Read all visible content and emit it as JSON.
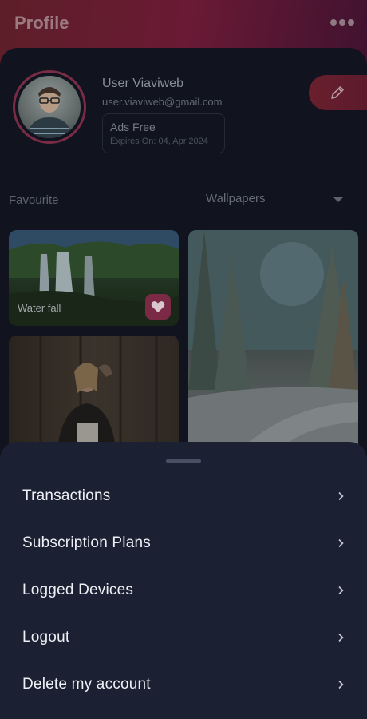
{
  "header": {
    "title": "Profile",
    "more_icon": "more-horizontal-icon"
  },
  "profile": {
    "name": "User Viaviweb",
    "email": "user.viaviweb@gmail.com",
    "plan": {
      "title": "Ads Free",
      "expiry": "Expires On: 04, Apr 2024"
    },
    "edit_icon": "pencil-icon"
  },
  "favourites": {
    "label": "Favourite",
    "category": "Wallpapers",
    "items": [
      {
        "title": "Water fall",
        "favourited": true
      },
      {
        "title": ""
      },
      {
        "title": ""
      }
    ]
  },
  "sheet": {
    "items": [
      {
        "label": "Transactions"
      },
      {
        "label": "Subscription Plans"
      },
      {
        "label": "Logged Devices"
      },
      {
        "label": "Logout"
      },
      {
        "label": "Delete my account"
      }
    ]
  },
  "colors": {
    "accent": "#7b2a46",
    "sheet_bg": "#1b2032",
    "page_bg": "#11141f"
  }
}
